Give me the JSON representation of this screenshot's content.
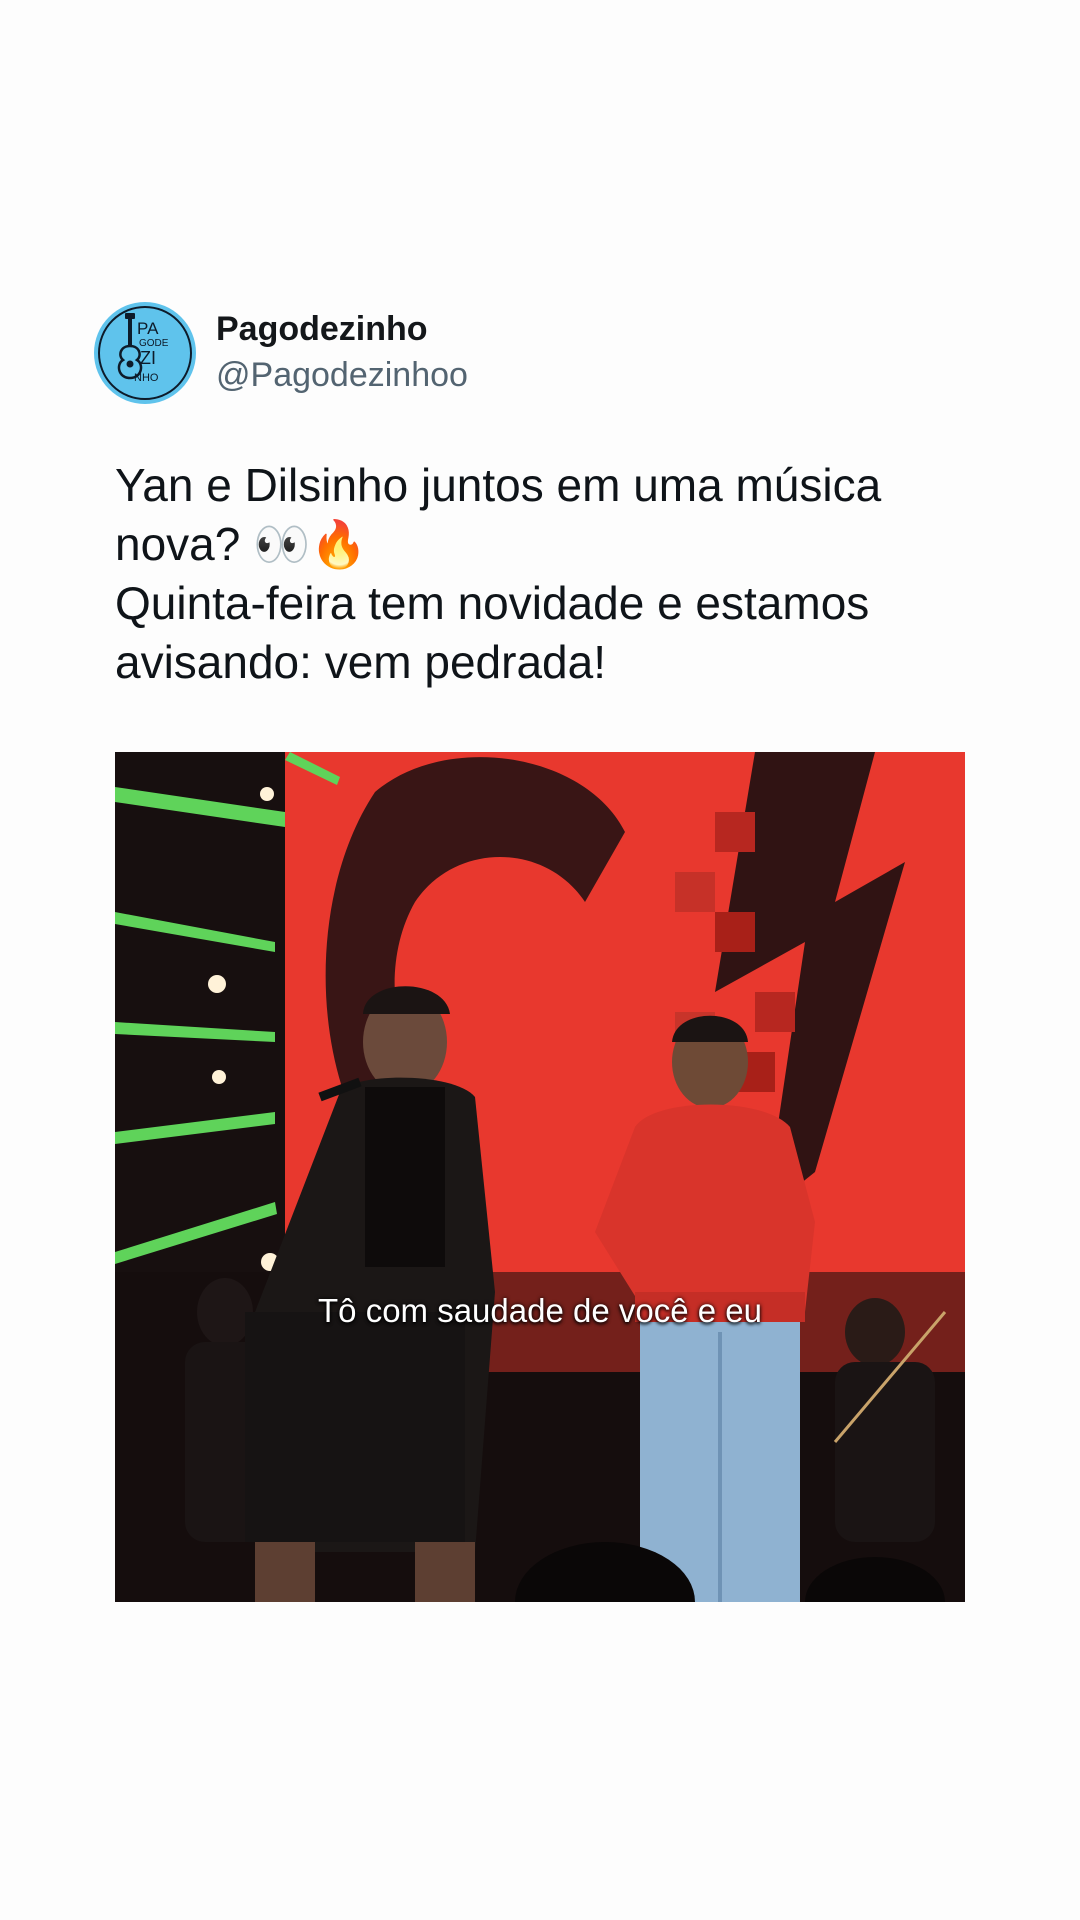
{
  "account": {
    "display_name": "Pagodezinho",
    "handle": "@Pagodezinhoo",
    "avatar_icon": "pagodezinho-guitar-logo-icon",
    "avatar_color": "#5fc3ec",
    "avatar_logo_text": "PAGODEZINHO"
  },
  "tweet": {
    "lines": [
      "Yan e Dilsinho juntos em uma música",
      "nova? 👀🔥",
      "Quinta-feira tem novidade e estamos",
      "avisando: vem pedrada!"
    ]
  },
  "media": {
    "type": "video-still",
    "caption": "Tô com saudade de você e eu",
    "colors": {
      "background_red": "#e8382e",
      "stage_green": "#5fd35a",
      "sweater_red": "#d9342b"
    }
  }
}
